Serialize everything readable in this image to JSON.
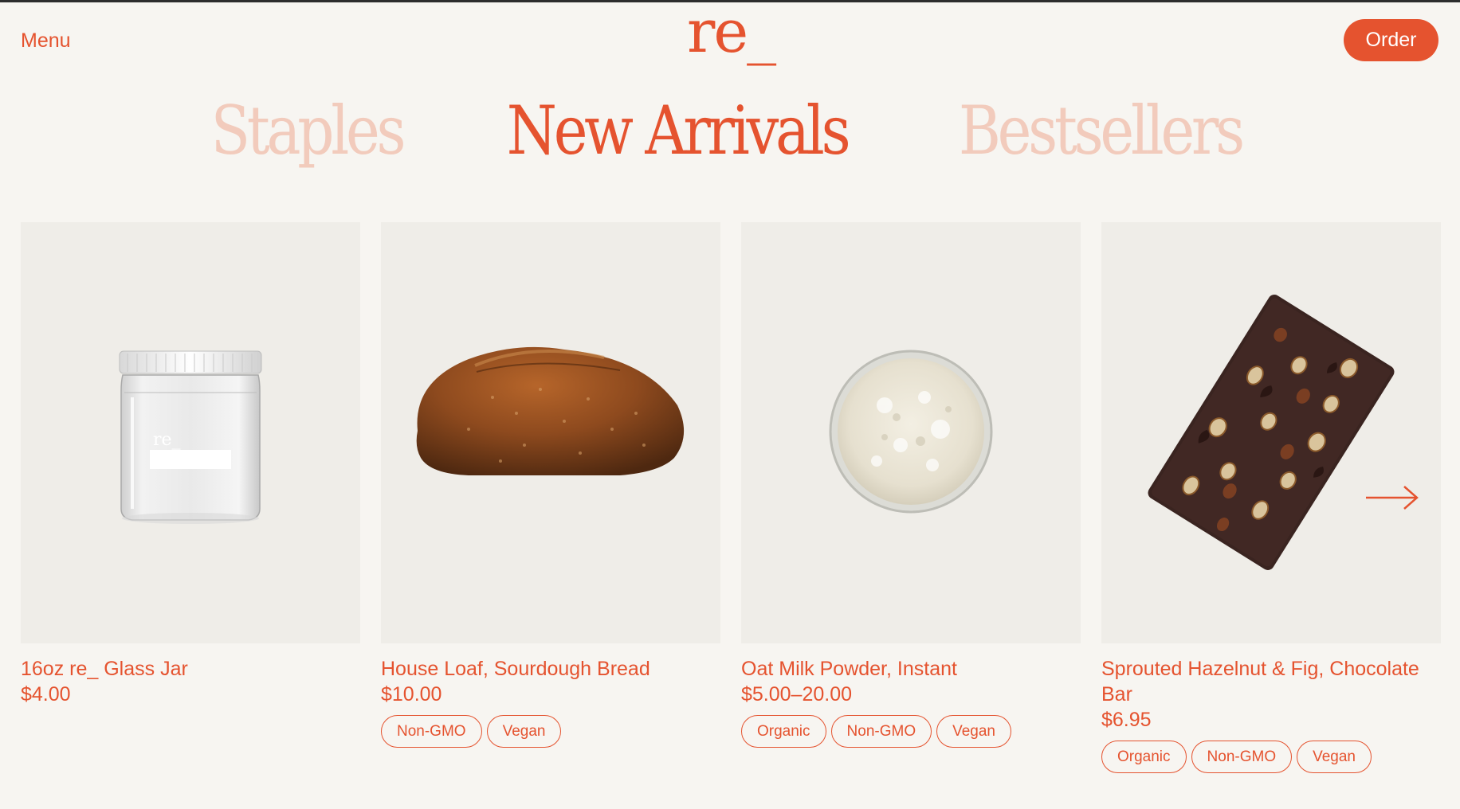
{
  "header": {
    "menu_label": "Menu",
    "logo_text": "re_",
    "order_label": "Order"
  },
  "tabs": [
    {
      "label": "Staples",
      "active": false
    },
    {
      "label": "New Arrivals",
      "active": true
    },
    {
      "label": "Bestsellers",
      "active": false
    }
  ],
  "products": [
    {
      "name": "16oz re_ Glass Jar",
      "price": "$4.00",
      "tags": [],
      "image": "glass-jar-image",
      "jar_logo": "re_"
    },
    {
      "name": "House Loaf, Sourdough Bread",
      "price": "$10.00",
      "tags": [
        "Non-GMO",
        "Vegan"
      ],
      "image": "bread-loaf-image"
    },
    {
      "name": "Oat Milk Powder, Instant",
      "price": "$5.00–20.00",
      "tags": [
        "Organic",
        "Non-GMO",
        "Vegan"
      ],
      "image": "oat-powder-bowl-image"
    },
    {
      "name": "Sprouted Hazelnut & Fig, Chocolate Bar",
      "price": "$6.95",
      "tags": [
        "Organic",
        "Non-GMO",
        "Vegan"
      ],
      "image": "chocolate-bar-image"
    }
  ],
  "carousel": {
    "next_icon": "arrow-right-icon"
  },
  "colors": {
    "accent": "#e5532f",
    "tab_inactive": "#f2cbbc",
    "background": "#f7f5f1",
    "card_background": "#efede8"
  }
}
